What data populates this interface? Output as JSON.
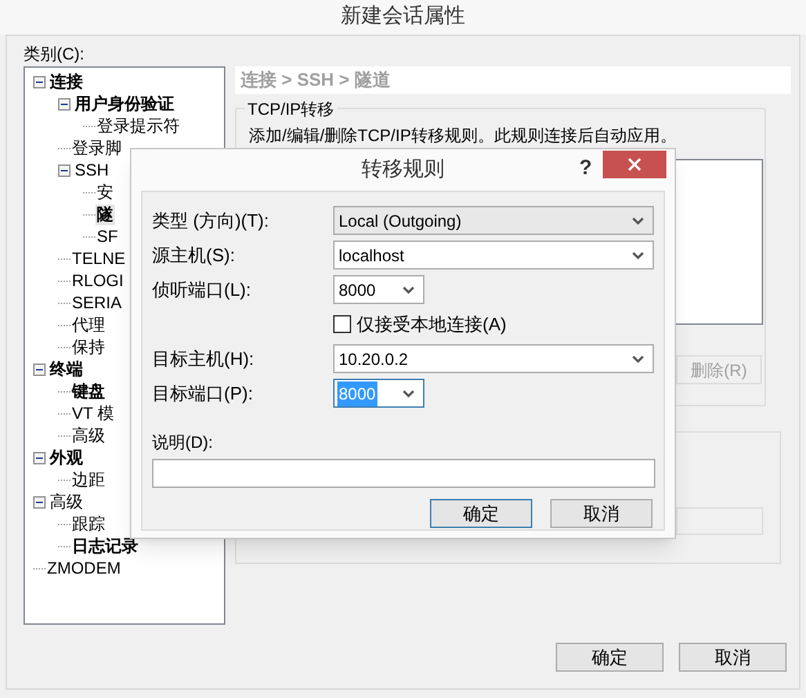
{
  "window": {
    "title": "新建会话属性"
  },
  "category_label": "类别(C):",
  "tree": [
    {
      "label": "连接",
      "bold": true,
      "expanded": true,
      "selected": false,
      "children": [
        {
          "label": "用户身份验证",
          "bold": true,
          "expanded": true,
          "selected": false,
          "children": [
            {
              "label": "登录提示符",
              "bold": false,
              "selected": false
            }
          ]
        },
        {
          "label": "登录脚",
          "bold": false,
          "selected": false
        },
        {
          "label": "SSH",
          "bold": false,
          "expanded": true,
          "selected": false,
          "children": [
            {
              "label": "安",
              "bold": false,
              "selected": false
            },
            {
              "label": "隧",
              "bold": true,
              "selected": true
            },
            {
              "label": "SF",
              "bold": false,
              "selected": false
            }
          ]
        },
        {
          "label": "TELNE",
          "bold": false,
          "selected": false
        },
        {
          "label": "RLOGI",
          "bold": false,
          "selected": false
        },
        {
          "label": "SERIA",
          "bold": false,
          "selected": false
        },
        {
          "label": "代理",
          "bold": false,
          "selected": false
        },
        {
          "label": "保持",
          "bold": false,
          "selected": false
        }
      ]
    },
    {
      "label": "终端",
      "bold": true,
      "expanded": true,
      "selected": false,
      "children": [
        {
          "label": "键盘",
          "bold": true,
          "selected": false
        },
        {
          "label": "VT 模",
          "bold": false,
          "selected": false
        },
        {
          "label": "高级",
          "bold": false,
          "selected": false
        }
      ]
    },
    {
      "label": "外观",
      "bold": true,
      "expanded": true,
      "selected": false,
      "children": [
        {
          "label": "边距",
          "bold": false,
          "selected": false
        }
      ]
    },
    {
      "label": "高级",
      "bold": false,
      "expanded": true,
      "selected": false,
      "children": [
        {
          "label": "跟踪",
          "bold": false,
          "selected": false
        },
        {
          "label": "日志记录",
          "bold": true,
          "selected": false
        }
      ]
    },
    {
      "label": "ZMODEM",
      "bold": false,
      "selected": false
    }
  ],
  "breadcrumb": "连接 > SSH > 隧道",
  "group": {
    "title": "TCP/IP转移",
    "description": "添加/编辑/删除TCP/IP转移规则。此规则连接后自动应用。",
    "delete_button": {
      "label": "删除(R)",
      "disabled": true
    }
  },
  "buttons": [
    "确定",
    "取消"
  ],
  "dialog": {
    "title": "转移规则",
    "help": "?",
    "fields": [
      {
        "kind": "select",
        "label": "类型 (方向)(T):",
        "value": "Local (Outgoing)",
        "wide": true,
        "focused": false
      },
      {
        "kind": "combo",
        "label": "源主机(S):",
        "value": "localhost",
        "wide": true,
        "focused": false
      },
      {
        "kind": "combo",
        "label": "侦听端口(L):",
        "value": "8000",
        "wide": false,
        "focused": false
      },
      {
        "kind": "checkbox",
        "label": "仅接受本地连接(A)",
        "checked": false
      },
      {
        "kind": "combo",
        "label": "目标主机(H):",
        "value": "10.20.0.2",
        "wide": true,
        "focused": false
      },
      {
        "kind": "combo",
        "label": "目标端口(P):",
        "value": "8000",
        "wide": false,
        "focused": true
      }
    ],
    "description_label": "说明(D):",
    "buttons": [
      {
        "label": "确定",
        "default": true
      },
      {
        "label": "取消",
        "default": false
      }
    ]
  }
}
